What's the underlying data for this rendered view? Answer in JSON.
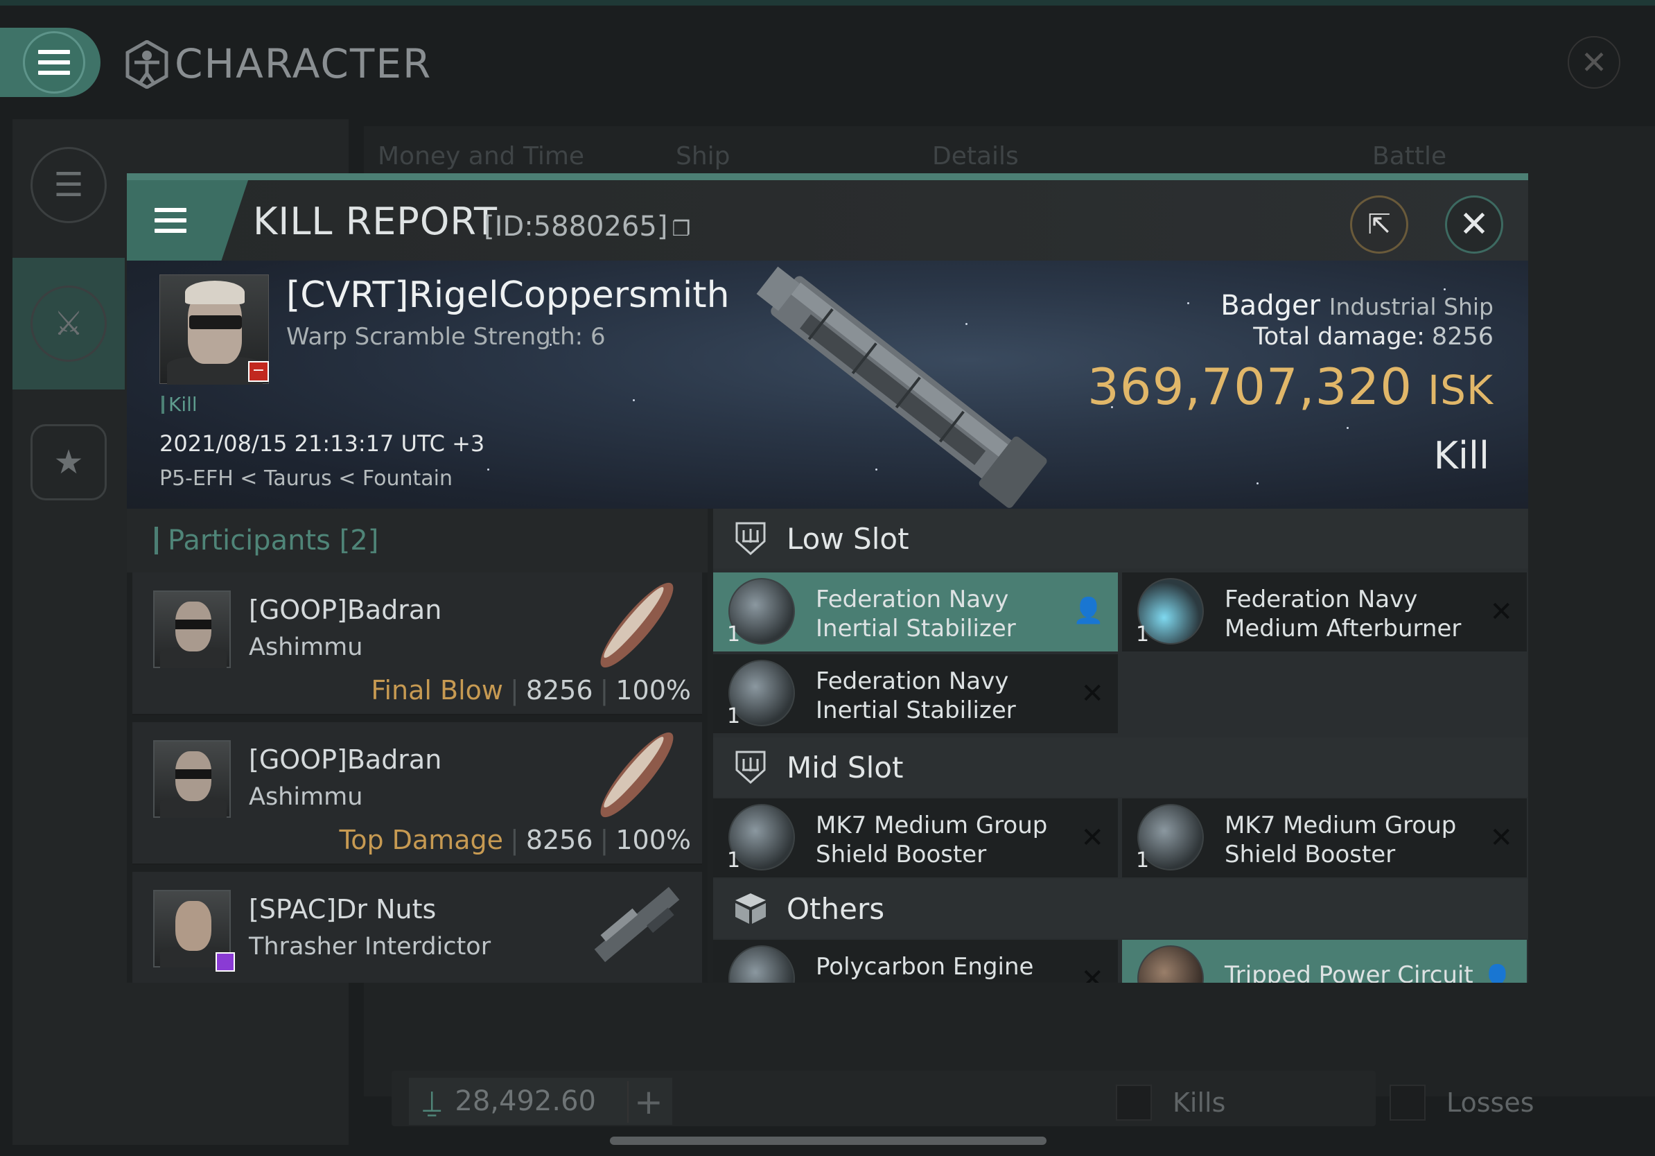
{
  "app": {
    "title": "CHARACTER",
    "tabs": [
      "Money and Time",
      "Ship",
      "Details",
      "Battle Status"
    ],
    "footer": {
      "wallet": "28,492.60",
      "kills_label": "Kills",
      "losses_label": "Losses"
    }
  },
  "modal": {
    "title": "KILL REPORT",
    "id_label": "[ID:5880265]",
    "victim": {
      "name": "[CVRT]RigelCoppersmith",
      "warp": "Warp Scramble Strength: 6",
      "tag": "Kill",
      "datetime": "2021/08/15 21:13:17 UTC +3",
      "location": "P5-EFH < Taurus < Fountain"
    },
    "ship": {
      "name": "Badger",
      "class": "Industrial Ship",
      "damage_label": "Total damage:",
      "damage_value": "8256",
      "isk_value": "369,707,320",
      "isk_unit": "ISK",
      "result": "Kill"
    },
    "participants": {
      "header": "Participants [2]",
      "rows": [
        {
          "name": "[GOOP]Badran",
          "ship": "Ashimmu",
          "label": "Final Blow",
          "damage": "8256",
          "percent": "100%"
        },
        {
          "name": "[GOOP]Badran",
          "ship": "Ashimmu",
          "label": "Top Damage",
          "damage": "8256",
          "percent": "100%"
        },
        {
          "name": "[SPAC]Dr Nuts",
          "ship": "Thrasher Interdictor",
          "label": "",
          "damage": "",
          "percent": ""
        }
      ]
    },
    "fitting": {
      "low_slot": "Low Slot",
      "mid_slot": "Mid Slot",
      "others": "Others",
      "low": [
        {
          "name1": "Federation Navy",
          "name2": "Inertial Stabilizer",
          "qty": "1",
          "status": "dropped"
        },
        {
          "name1": "Federation Navy",
          "name2": "Medium Afterburner",
          "qty": "1",
          "status": "destroyed"
        },
        {
          "name1": "Federation Navy",
          "name2": "Inertial Stabilizer",
          "qty": "1",
          "status": "destroyed"
        }
      ],
      "mid": [
        {
          "name1": "MK7 Medium Group",
          "name2": "Shield Booster",
          "qty": "1",
          "status": "destroyed"
        },
        {
          "name1": "MK7 Medium Group",
          "name2": "Shield Booster",
          "qty": "1",
          "status": "destroyed"
        }
      ],
      "other": [
        {
          "name1": "Polycarbon Engine",
          "name2": "",
          "status": "destroyed"
        },
        {
          "name1": "Tripped Power Circuit",
          "name2": "",
          "status": "dropped"
        }
      ]
    }
  },
  "colors": {
    "accent": "#4c7f74",
    "isk": "#e1b769",
    "final_blow": "#c79a52",
    "destroyed_row": "#1e2122",
    "dropped_row": "#4a7e73"
  }
}
